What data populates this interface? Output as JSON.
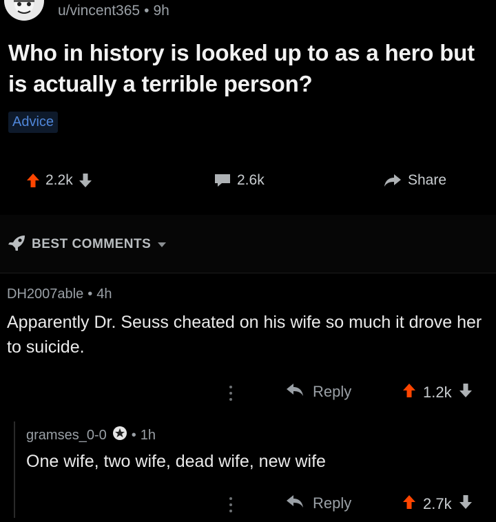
{
  "post": {
    "author": "u/vincent365",
    "separator": "•",
    "time": "9h",
    "title": "Who in history is looked up to as a hero but is actually a terrible person?",
    "flair": "Advice",
    "score": "2.2k",
    "comments_count": "2.6k",
    "share_label": "Share"
  },
  "sort": {
    "label": "BEST COMMENTS"
  },
  "comments": [
    {
      "author": "DH2007able",
      "separator": "•",
      "time": "4h",
      "body": "Apparently Dr. Seuss cheated on his wife so much it drove her to suicide.",
      "reply_label": "Reply",
      "score": "1.2k"
    },
    {
      "author": "gramses_0-0",
      "separator": "•",
      "time": "1h",
      "body": "One wife, two wife, dead wife, new wife",
      "reply_label": "Reply",
      "score": "2.7k"
    }
  ],
  "colors": {
    "upvote": "#ff4500",
    "flair_text": "#4f86d9",
    "flair_bg": "#0e1a2b",
    "text_muted": "#9aa0a6",
    "background": "#000000"
  },
  "icons": [
    "avatar-icon",
    "upvote-arrow-icon",
    "downvote-arrow-icon",
    "comment-bubble-icon",
    "share-arrow-icon",
    "rocket-icon",
    "caret-down-icon",
    "more-options-icon",
    "reply-arrow-icon",
    "award-icon"
  ]
}
